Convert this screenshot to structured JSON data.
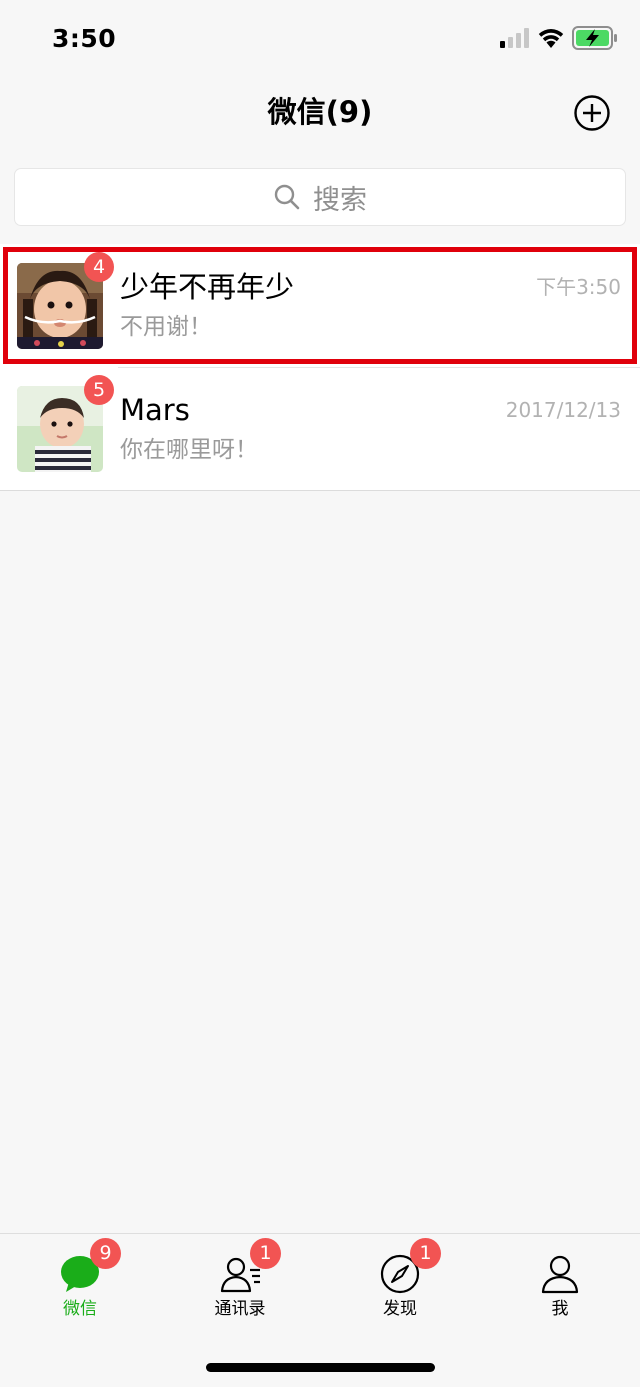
{
  "status_bar": {
    "time": "3:50"
  },
  "nav": {
    "title": "微信(9)",
    "add_icon": "plus-circle-icon"
  },
  "search": {
    "placeholder": "搜索",
    "icon": "search-icon"
  },
  "chats": [
    {
      "name": "少年不再年少",
      "time": "下午3:50",
      "preview": "不用谢！",
      "unread": "4",
      "selected": true
    },
    {
      "name": "Mars",
      "time": "2017/12/13",
      "preview": "你在哪里呀！",
      "unread": "5",
      "selected": false
    }
  ],
  "tabs": [
    {
      "label": "微信",
      "badge": "9",
      "icon": "chat-bubble-icon",
      "active": true
    },
    {
      "label": "通讯录",
      "badge": "1",
      "icon": "contacts-icon",
      "active": false
    },
    {
      "label": "发现",
      "badge": "1",
      "icon": "compass-icon",
      "active": false
    },
    {
      "label": "我",
      "badge": "",
      "icon": "person-icon",
      "active": false
    }
  ],
  "colors": {
    "accent_green": "#1aad19",
    "badge_red": "#f25453",
    "highlight_red": "#e0000b"
  }
}
